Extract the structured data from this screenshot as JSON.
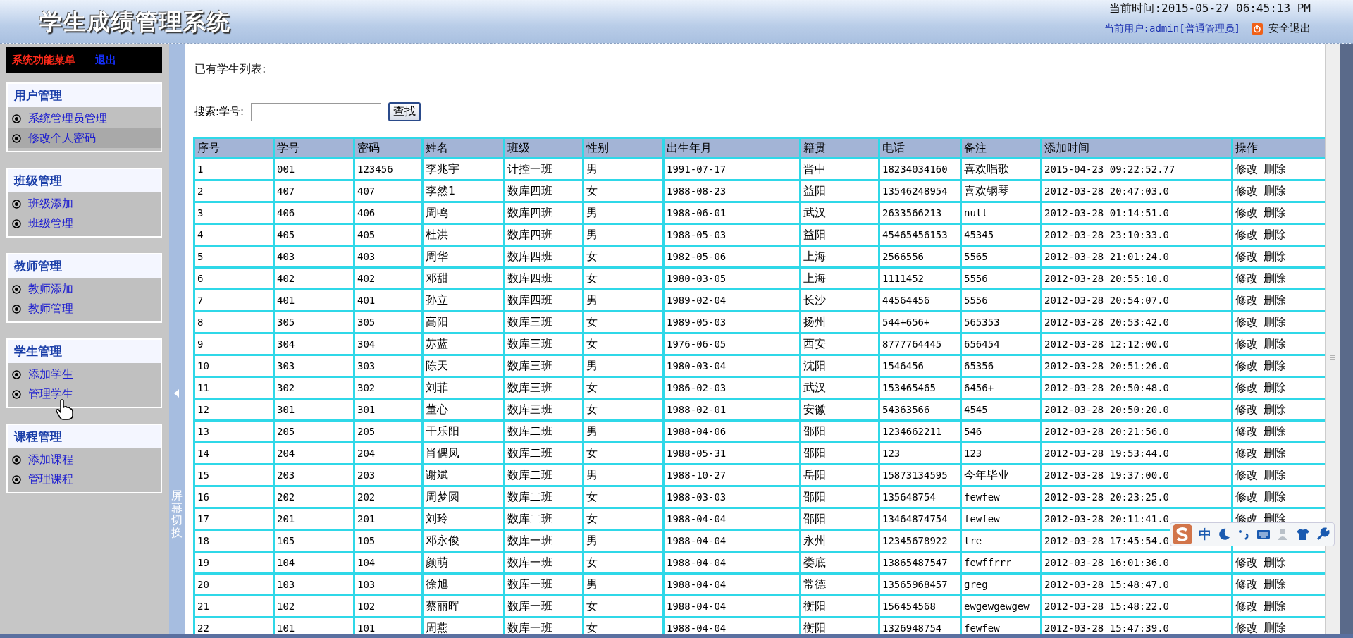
{
  "header": {
    "title": "学生成绩管理系统",
    "current_time": "当前时间:2015-05-27 06:45:13 PM",
    "current_user": "当前用户:admin[普通管理员]",
    "logout": "安全退出"
  },
  "sidebar": {
    "menu_title": "系统功能菜单",
    "exit": "退出",
    "groups": [
      {
        "title": "用户管理",
        "items": [
          {
            "label": "系统管理员管理",
            "selected": false
          },
          {
            "label": "修改个人密码",
            "selected": true
          }
        ]
      },
      {
        "title": "班级管理",
        "items": [
          {
            "label": "班级添加",
            "selected": false
          },
          {
            "label": "班级管理",
            "selected": false
          }
        ]
      },
      {
        "title": "教师管理",
        "items": [
          {
            "label": "教师添加",
            "selected": false
          },
          {
            "label": "教师管理",
            "selected": false
          }
        ]
      },
      {
        "title": "学生管理",
        "items": [
          {
            "label": "添加学生",
            "selected": false
          },
          {
            "label": "管理学生",
            "selected": false
          }
        ]
      },
      {
        "title": "课程管理",
        "items": [
          {
            "label": "添加课程",
            "selected": false
          },
          {
            "label": "管理课程",
            "selected": false
          }
        ]
      }
    ]
  },
  "splitter": {
    "label": "屏幕切换"
  },
  "content": {
    "heading": "已有学生列表:",
    "search": {
      "label": "搜索:学号:",
      "button": "查找"
    },
    "table": {
      "columns": [
        "序号",
        "学号",
        "密码",
        "姓名",
        "班级",
        "性别",
        "出生年月",
        "籍贯",
        "电话",
        "备注",
        "添加时间",
        "操作"
      ],
      "rows": [
        {
          "cells": [
            "1",
            "001",
            "123456",
            "李兆宇",
            "计控一班",
            "男",
            "1991-07-17",
            "晋中",
            "18234034160",
            "喜欢唱歌",
            "2015-04-23 09:22:52.77"
          ],
          "actions": [
            "修改",
            "删除"
          ]
        },
        {
          "cells": [
            "2",
            "407",
            "407",
            "李然1",
            "数库四班",
            "女",
            "1988-08-23",
            "益阳",
            "13546248954",
            "喜欢钢琴",
            "2012-03-28 20:47:03.0"
          ],
          "actions": [
            "修改",
            "删除"
          ]
        },
        {
          "cells": [
            "3",
            "406",
            "406",
            "周鸣",
            "数库四班",
            "男",
            "1988-06-01",
            "武汉",
            "2633566213",
            "null",
            "2012-03-28 01:14:51.0"
          ],
          "actions": [
            "修改",
            "删除"
          ]
        },
        {
          "cells": [
            "4",
            "405",
            "405",
            "杜洪",
            "数库四班",
            "男",
            "1988-05-03",
            "益阳",
            "45465456153",
            "45345",
            "2012-03-28 23:10:33.0"
          ],
          "actions": [
            "修改",
            "删除"
          ]
        },
        {
          "cells": [
            "5",
            "403",
            "403",
            "周华",
            "数库四班",
            "女",
            "1982-05-06",
            "上海",
            "2566556",
            "5565",
            "2012-03-28 21:01:24.0"
          ],
          "actions": [
            "修改",
            "删除"
          ]
        },
        {
          "cells": [
            "6",
            "402",
            "402",
            "邓甜",
            "数库四班",
            "女",
            "1980-03-05",
            "上海",
            "1111452",
            "5556",
            "2012-03-28 20:55:10.0"
          ],
          "actions": [
            "修改",
            "删除"
          ]
        },
        {
          "cells": [
            "7",
            "401",
            "401",
            "孙立",
            "数库四班",
            "男",
            "1989-02-04",
            "长沙",
            "44564456",
            "5556",
            "2012-03-28 20:54:07.0"
          ],
          "actions": [
            "修改",
            "删除"
          ]
        },
        {
          "cells": [
            "8",
            "305",
            "305",
            "高阳",
            "数库三班",
            "女",
            "1989-05-03",
            "扬州",
            "544+656+",
            "565353",
            "2012-03-28 20:53:42.0"
          ],
          "actions": [
            "修改",
            "删除"
          ]
        },
        {
          "cells": [
            "9",
            "304",
            "304",
            "苏蓝",
            "数库三班",
            "女",
            "1976-06-05",
            "西安",
            "8777764445",
            "656454",
            "2012-03-28 12:12:00.0"
          ],
          "actions": [
            "修改",
            "删除"
          ]
        },
        {
          "cells": [
            "10",
            "303",
            "303",
            "陈天",
            "数库三班",
            "男",
            "1980-03-04",
            "沈阳",
            "1546456",
            "65356",
            "2012-03-28 20:51:26.0"
          ],
          "actions": [
            "修改",
            "删除"
          ]
        },
        {
          "cells": [
            "11",
            "302",
            "302",
            "刘菲",
            "数库三班",
            "女",
            "1986-02-03",
            "武汉",
            "153465465",
            "6456+",
            "2012-03-28 20:50:48.0"
          ],
          "actions": [
            "修改",
            "删除"
          ]
        },
        {
          "cells": [
            "12",
            "301",
            "301",
            "董心",
            "数库三班",
            "女",
            "1988-02-01",
            "安徽",
            "54363566",
            "4545",
            "2012-03-28 20:50:20.0"
          ],
          "actions": [
            "修改",
            "删除"
          ]
        },
        {
          "cells": [
            "13",
            "205",
            "205",
            "干乐阳",
            "数库二班",
            "男",
            "1988-04-06",
            "邵阳",
            "1234662211",
            "546",
            "2012-03-28 20:21:56.0"
          ],
          "actions": [
            "修改",
            "删除"
          ]
        },
        {
          "cells": [
            "14",
            "204",
            "204",
            "肖偶凤",
            "数库二班",
            "女",
            "1988-05-31",
            "邵阳",
            "123",
            "123",
            "2012-03-28 19:53:44.0"
          ],
          "actions": [
            "修改",
            "删除"
          ]
        },
        {
          "cells": [
            "15",
            "203",
            "203",
            "谢斌",
            "数库二班",
            "男",
            "1988-10-27",
            "岳阳",
            "15873134595",
            "今年毕业",
            "2012-03-28 19:37:00.0"
          ],
          "actions": [
            "修改",
            "删除"
          ]
        },
        {
          "cells": [
            "16",
            "202",
            "202",
            "周梦圆",
            "数库二班",
            "女",
            "1988-03-03",
            "邵阳",
            "135648754",
            "fewfew",
            "2012-03-28 20:23:25.0"
          ],
          "actions": [
            "修改",
            "删除"
          ]
        },
        {
          "cells": [
            "17",
            "201",
            "201",
            "刘玲",
            "数库二班",
            "女",
            "1988-04-04",
            "邵阳",
            "13464874754",
            "fewfew",
            "2012-03-28 20:11:41.0"
          ],
          "actions": [
            "修改",
            "删除"
          ]
        },
        {
          "cells": [
            "18",
            "105",
            "105",
            "邓永俊",
            "数库一班",
            "男",
            "1988-04-04",
            "永州",
            "12345678922",
            "tre",
            "2012-03-28 17:45:54.0"
          ]
        },
        {
          "cells": [
            "19",
            "104",
            "104",
            "颜萌",
            "数库一班",
            "女",
            "1988-04-04",
            "娄底",
            "13865487547",
            "fewffrrr",
            "2012-03-28 16:01:36.0"
          ],
          "actions": [
            "修改",
            "删除"
          ]
        },
        {
          "cells": [
            "20",
            "103",
            "103",
            "徐旭",
            "数库一班",
            "男",
            "1988-04-04",
            "常德",
            "13565968457",
            "greg",
            "2012-03-28 15:48:47.0"
          ],
          "actions": [
            "修改",
            "删除"
          ]
        },
        {
          "cells": [
            "21",
            "102",
            "102",
            "蔡丽晖",
            "数库一班",
            "女",
            "1988-04-04",
            "衡阳",
            "156454568",
            "ewgewgewgew",
            "2012-03-28 15:48:22.0"
          ],
          "actions": [
            "修改",
            "删除"
          ]
        },
        {
          "cells": [
            "22",
            "101",
            "101",
            "周燕",
            "数库一班",
            "女",
            "1988-04-04",
            "衡阳",
            "1326948754",
            "fewfew",
            "2012-03-28 15:47:39.0"
          ],
          "actions": [
            "修改",
            "删除"
          ]
        }
      ]
    }
  },
  "ime_toolbar": {
    "mode": "中"
  }
}
